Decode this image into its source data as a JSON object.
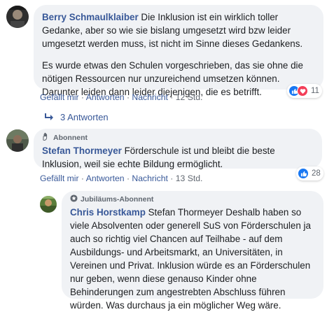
{
  "comments": [
    {
      "author": "Berry Schmaulklaiber",
      "text1": " Die Inklusion ist ein wirklich toller Gedanke, aber so wie sie bislang umgesetzt wird bzw leider umgesetzt werden muss, ist nicht im Sinne dieses Gedankens.",
      "text2": "Es wurde etwas den Schulen vorgeschrieben, das sie ohne die nötigen Ressourcen nur unzureichend umsetzen können. Darunter leiden dann leider diejenigen, die es betrifft.",
      "actions": {
        "like": "Gefällt mir",
        "reply": "Antworten",
        "message": "Nachricht",
        "time": "12 Std."
      },
      "reaction_count": "11",
      "reaction_icons": [
        "like-icon",
        "love-icon"
      ],
      "replies_label": "3 Antworten"
    },
    {
      "badge": "Abonnent",
      "badge_icon": "wave-hand-icon",
      "author": "Stefan Thormeyer",
      "text1": " Förderschule ist und bleibt die beste Inklusion, weil sie echte Bildung ermöglicht.",
      "actions": {
        "like": "Gefällt mir",
        "reply": "Antworten",
        "message": "Nachricht",
        "time": "13 Std."
      },
      "reaction_count": "28",
      "reaction_icons": [
        "like-icon"
      ]
    },
    {
      "badge": "Jubiläums-Abonnent",
      "badge_icon": "anniversary-badge-icon",
      "author": "Chris Horstkamp",
      "text1": " Stefan Thormeyer Deshalb haben so viele Absolventen oder generell SuS von Förderschulen ja auch so richtig viel Chancen auf Teilhabe - auf dem Ausbildungs- und Arbeitsmarkt, an Universitäten, in Vereinen und Privat. Inklusion würde es an Förderschulen nur geben, wenn diese genauso Kinder ohne Behinderungen zum angestrebten Abschluss führen würden. Was durchaus ja ein möglicher Weg wäre."
    }
  ],
  "separator": "·",
  "colors": {
    "link": "#385898",
    "bubble": "#f0f2f5",
    "like": "#1877f2",
    "love": "#f33e58"
  }
}
